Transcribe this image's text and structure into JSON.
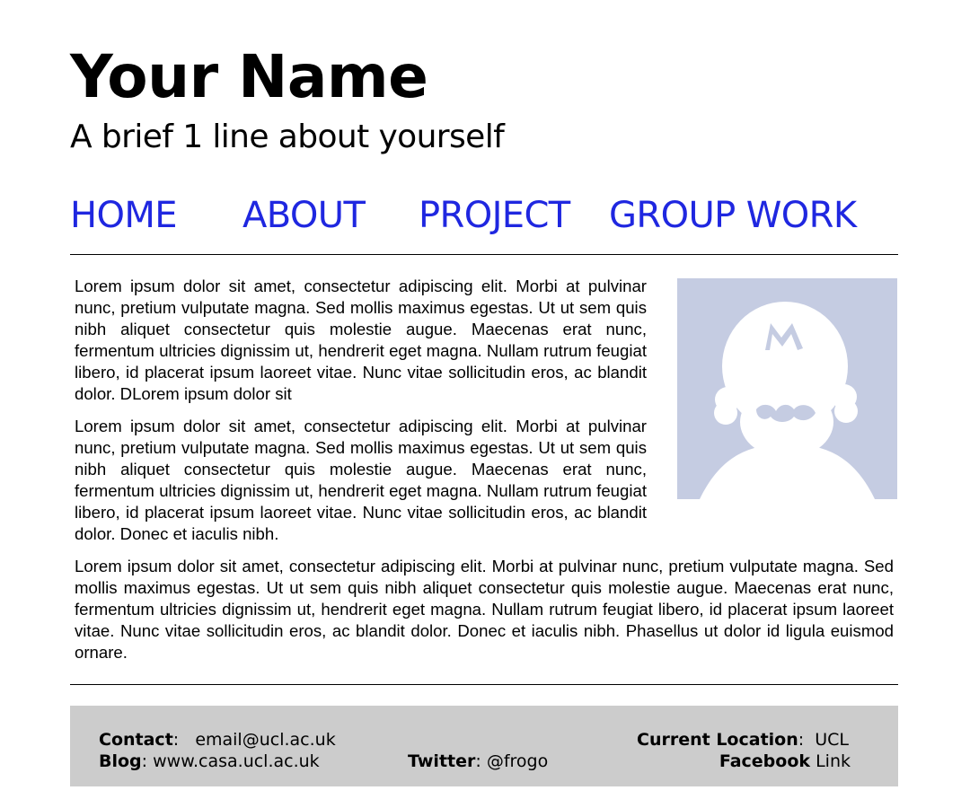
{
  "header": {
    "title": "Your Name",
    "tagline": "A brief 1 line about yourself"
  },
  "nav": {
    "items": [
      "HOME",
      "ABOUT",
      "PROJECT",
      "GROUP WORK"
    ],
    "link_color": "#1f27e0"
  },
  "main": {
    "paragraphs": [
      "Lorem ipsum dolor sit amet, consectetur adipiscing elit. Morbi at pulvinar nunc, pretium vulputate magna. Sed mollis maximus egestas. Ut ut sem quis nibh aliquet consectetur quis molestie augue. Maecenas erat nunc, fermentum ultricies dignissim ut, hendrerit eget magna. Nullam rutrum feugiat libero, id placerat ipsum laoreet vitae. Nunc vitae sollicitudin eros, ac blandit dolor. DLorem ipsum dolor sit",
      "Lorem ipsum dolor sit amet, consectetur adipiscing elit. Morbi at pulvinar nunc, pretium vulputate magna. Sed mollis maximus egestas. Ut ut sem quis nibh aliquet consectetur quis molestie augue. Maecenas erat nunc, fermentum ultricies dignissim ut, hendrerit eget magna. Nullam rutrum feugiat libero, id placerat ipsum laoreet vitae. Nunc vitae sollicitudin eros, ac blandit dolor. Donec et iaculis nibh.",
      "Lorem ipsum dolor sit amet, consectetur adipiscing elit. Morbi at pulvinar nunc, pretium vulputate magna. Sed mollis maximus egestas. Ut ut sem quis nibh aliquet consectetur quis molestie augue. Maecenas erat nunc, fermentum ultricies dignissim ut, hendrerit eget magna. Nullam rutrum feugiat libero, id placerat ipsum laoreet vitae. Nunc vitae sollicitudin eros, ac blandit dolor. Donec et iaculis nibh. Phasellus ut dolor id ligula euismod ornare."
    ],
    "avatar": {
      "icon": "default-profile-avatar-icon",
      "background_color": "#c5cce2"
    }
  },
  "footer": {
    "background_color": "#cccccc",
    "contact_label": "Contact",
    "contact_value": "email@ucl.ac.uk",
    "blog_label": "Blog",
    "blog_value": "www.casa.ucl.ac.uk",
    "twitter_label": "Twitter",
    "twitter_value": "@frogo",
    "location_label": "Current Location",
    "location_value": "UCL",
    "facebook_label": "Facebook",
    "facebook_value": "Link"
  }
}
